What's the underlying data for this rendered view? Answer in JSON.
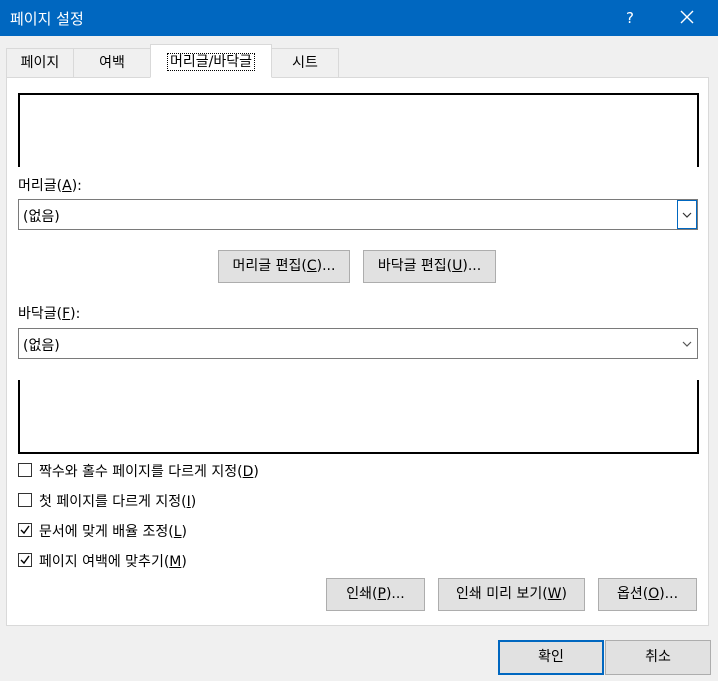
{
  "window": {
    "title": "페이지 설정",
    "help_label": "?"
  },
  "tabs": [
    {
      "label": "페이지"
    },
    {
      "label": "여백"
    },
    {
      "label": "머리글/바닥글",
      "active": true
    },
    {
      "label": "시트"
    }
  ],
  "header": {
    "label_prefix": "머리글(",
    "label_key": "A",
    "label_suffix": "):",
    "value": "(없음)"
  },
  "edit_buttons": {
    "header_edit": {
      "prefix": "머리글 편집(",
      "key": "C",
      "suffix": ")..."
    },
    "footer_edit": {
      "prefix": "바닥글 편집(",
      "key": "U",
      "suffix": ")..."
    }
  },
  "footer": {
    "label_prefix": "바닥글(",
    "label_key": "F",
    "label_suffix": "):",
    "value": "(없음)"
  },
  "options": [
    {
      "prefix": "짝수와 홀수 페이지를 다르게 지정(",
      "key": "D",
      "suffix": ")",
      "checked": false
    },
    {
      "prefix": "첫 페이지를 다르게 지정(",
      "key": "I",
      "suffix": ")",
      "checked": false
    },
    {
      "prefix": "문서에 맞게 배율 조정(",
      "key": "L",
      "suffix": ")",
      "checked": true
    },
    {
      "prefix": "페이지 여백에 맞추기(",
      "key": "M",
      "suffix": ")",
      "checked": true
    }
  ],
  "action_buttons": {
    "print": {
      "prefix": "인쇄(",
      "key": "P",
      "suffix": ")..."
    },
    "preview": {
      "prefix": "인쇄 미리 보기(",
      "key": "W",
      "suffix": ")"
    },
    "options": {
      "prefix": "옵션(",
      "key": "O",
      "suffix": ")..."
    }
  },
  "dialog_buttons": {
    "ok": "확인",
    "cancel": "취소"
  },
  "colors": {
    "titlebar": "#0067c0",
    "dialog_bg": "#f0f0f0",
    "button_bg": "#e1e1e1",
    "focus_border": "#0067c0"
  }
}
